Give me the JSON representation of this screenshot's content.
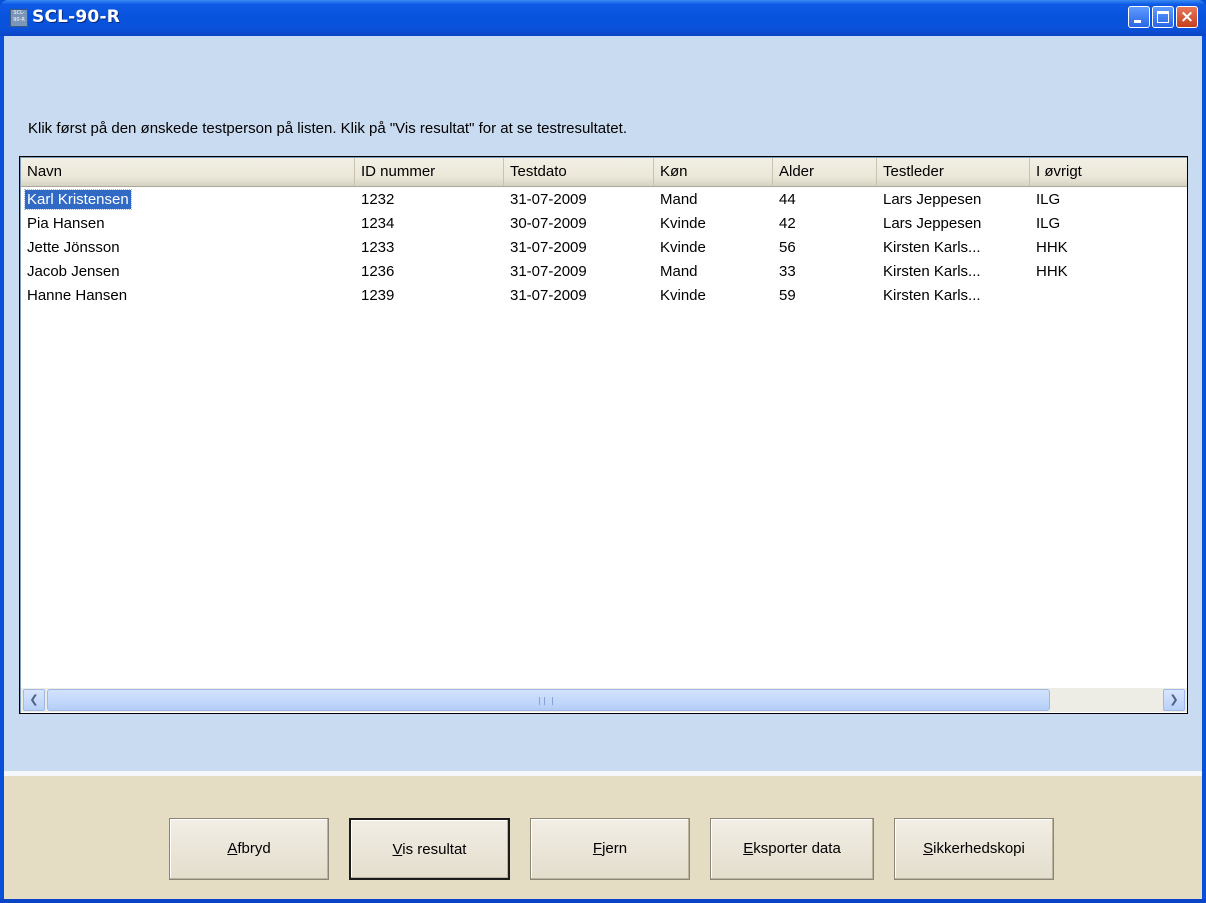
{
  "window": {
    "title": "SCL-90-R",
    "icon_text": "SCL-90-R",
    "controls": {
      "minimize": "minimize",
      "maximize": "maximize",
      "close": "×"
    }
  },
  "instruction": "Klik først på den ønskede testperson på listen. Klik på \"Vis resultat\" for at se testresultatet.",
  "table": {
    "columns": [
      "Navn",
      "ID nummer",
      "Testdato",
      "Køn",
      "Alder",
      "Testleder",
      "I øvrigt"
    ],
    "rows": [
      [
        "Karl Kristensen",
        "1232",
        "31-07-2009",
        "Mand",
        "44",
        "Lars Jeppesen",
        "ILG"
      ],
      [
        "Pia Hansen",
        "1234",
        "30-07-2009",
        "Kvinde",
        "42",
        "Lars Jeppesen",
        "ILG"
      ],
      [
        "Jette Jönsson",
        "1233",
        "31-07-2009",
        "Kvinde",
        "56",
        "Kirsten Karls...",
        "HHK"
      ],
      [
        "Jacob Jensen",
        "1236",
        "31-07-2009",
        "Mand",
        "33",
        "Kirsten Karls...",
        "HHK"
      ],
      [
        "Hanne Hansen",
        "1239",
        "31-07-2009",
        "Kvinde",
        "59",
        "Kirsten Karls...",
        ""
      ]
    ],
    "selected_row": 0
  },
  "buttons": {
    "afbryd": {
      "mnemonic": "A",
      "rest": "fbryd"
    },
    "vis_resultat": {
      "mnemonic": "V",
      "rest": "is resultat"
    },
    "fjern": {
      "mnemonic": "F",
      "rest": "jern"
    },
    "eksporter": {
      "mnemonic": "E",
      "rest": "ksporter data"
    },
    "sikkerhedskopi": {
      "mnemonic": "S",
      "rest": "ikkerhedskopi"
    }
  },
  "colors": {
    "titlebar": "#0853dd",
    "client_bg": "#c9dbf0",
    "bottom_panel": "#e5dcc4",
    "selection": "#316ac5"
  }
}
